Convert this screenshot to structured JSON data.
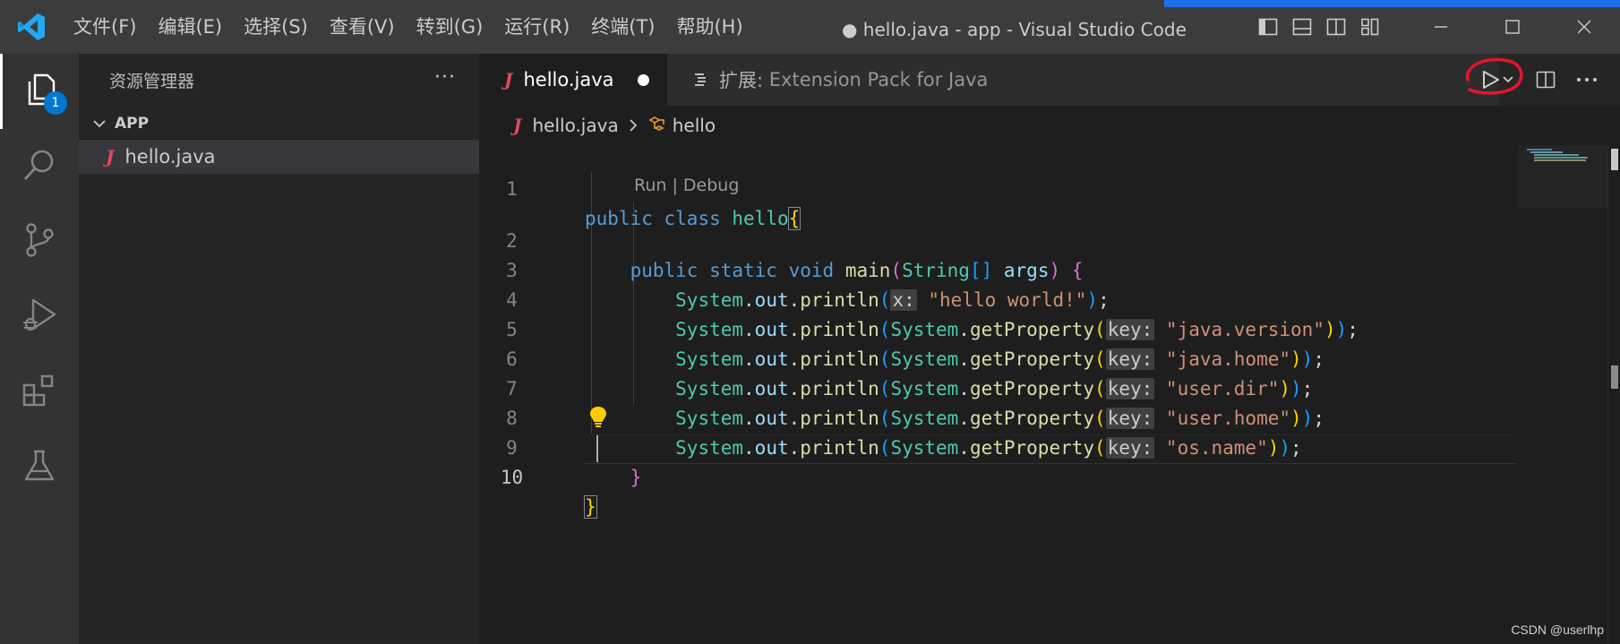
{
  "window": {
    "title": "● hello.java - app - Visual Studio Code",
    "menu": [
      "文件(F)",
      "编辑(E)",
      "选择(S)",
      "查看(V)",
      "转到(G)",
      "运行(R)",
      "终端(T)",
      "帮助(H)"
    ]
  },
  "activity_bar": {
    "items": [
      "explorer",
      "search",
      "source-control",
      "run-and-debug",
      "extensions",
      "testing"
    ],
    "explorer_badge": "1"
  },
  "sidebar": {
    "title": "资源管理器",
    "more": "···",
    "folder": "APP",
    "files": [
      "hello.java"
    ]
  },
  "tabs": {
    "active": {
      "icon": "J",
      "label": "hello.java",
      "modified": true
    },
    "inactive": {
      "prefix": "扩展:",
      "label": "Extension Pack for Java"
    }
  },
  "breadcrumb": {
    "file": "hello.java",
    "symbol": "hello"
  },
  "editor": {
    "codelens": "Run | Debug",
    "line_numbers": [
      "1",
      "2",
      "3",
      "4",
      "5",
      "6",
      "7",
      "8",
      "9",
      "10"
    ],
    "current_line": "10",
    "code": {
      "l1": {
        "kw1": "public",
        "kw2": "class",
        "name": "hello",
        "brace": "{"
      },
      "l2": {
        "kw1": "public",
        "kw2": "static",
        "kw3": "void",
        "fn": "main",
        "p1": "(",
        "type": "String",
        "arr": "[]",
        "arg": "args",
        "p2": ")",
        "brace": "{"
      },
      "l3": {
        "cls": "System",
        "out": "out",
        "fn": "println",
        "open": "(",
        "hint": "x:",
        "str": "\"hello world!\"",
        "close": ")",
        "semi": ";"
      },
      "l4": {
        "str": "\"java.version\""
      },
      "l5": {
        "str": "\"java.home\""
      },
      "l6": {
        "str": "\"user.dir\""
      },
      "l7": {
        "str": "\"user.home\""
      },
      "l8": {
        "str": "\"os.name\""
      },
      "prop_call": {
        "cls": "System",
        "fn": "getProperty",
        "hint": "key:"
      },
      "l9": {
        "brace": "}"
      },
      "l10": {
        "brace": "}"
      }
    }
  },
  "watermark": "CSDN @userlhp",
  "colors": {
    "titlebar": "#3c3c3c",
    "activitybar": "#333333",
    "sidebar": "#252526",
    "editor": "#1e1e1e",
    "accent": "#0078d4",
    "java_icon": "#e0475d",
    "annotation_circle": "#e8142a"
  }
}
